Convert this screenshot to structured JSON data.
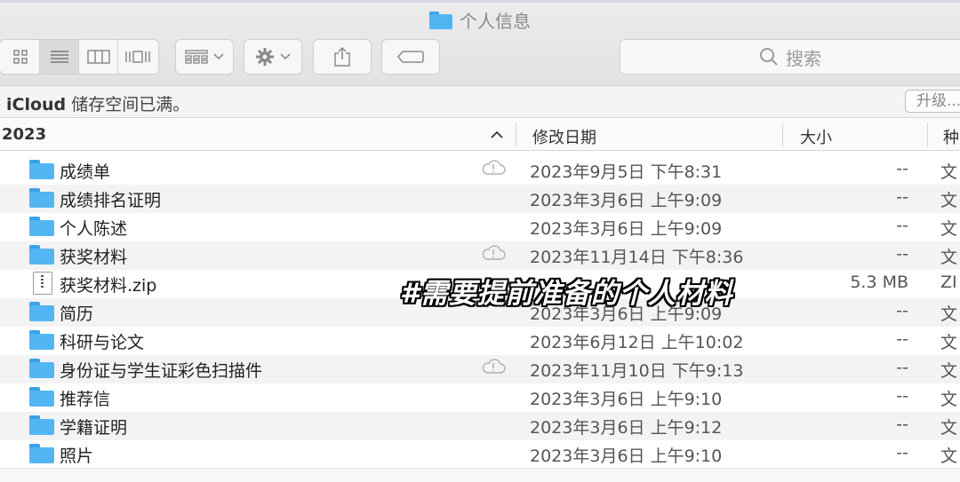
{
  "window": {
    "title": "个人信息"
  },
  "toolbar": {
    "view_buttons": [
      {
        "icon": "icon-view-icon",
        "active": false
      },
      {
        "icon": "list-view-icon",
        "active": true
      },
      {
        "icon": "column-view-icon",
        "active": false
      },
      {
        "icon": "gallery-view-icon",
        "active": false
      }
    ],
    "group_icon": "group-grid-icon",
    "action_icon": "gear-icon",
    "share_icon": "share-icon",
    "tag_icon": "tag-icon",
    "search_placeholder": "搜索"
  },
  "icloud_bar": {
    "brand": "iCloud",
    "message": "储存空间已满。",
    "upgrade_label": "升级..."
  },
  "columns": {
    "name": "2023",
    "date": "修改日期",
    "size": "大小",
    "kind": "种"
  },
  "files": [
    {
      "name": "成绩单",
      "date": "2023年9月5日 下午8:31",
      "size": "--",
      "kind": "文",
      "type": "folder",
      "cloud": true
    },
    {
      "name": "成绩排名证明",
      "date": "2023年3月6日 上午9:09",
      "size": "--",
      "kind": "文",
      "type": "folder",
      "cloud": false
    },
    {
      "name": "个人陈述",
      "date": "2023年3月6日 上午9:09",
      "size": "--",
      "kind": "文",
      "type": "folder",
      "cloud": false
    },
    {
      "name": "获奖材料",
      "date": "2023年11月14日 下午8:36",
      "size": "--",
      "kind": "文",
      "type": "folder",
      "cloud": true
    },
    {
      "name": "获奖材料.zip",
      "date": "",
      "size": "5.3 MB",
      "kind": "ZI",
      "type": "zip",
      "cloud": false
    },
    {
      "name": "简历",
      "date": "2023年3月6日 上午9:09",
      "size": "--",
      "kind": "文",
      "type": "folder",
      "cloud": false
    },
    {
      "name": "科研与论文",
      "date": "2023年6月12日 上午10:02",
      "size": "--",
      "kind": "文",
      "type": "folder",
      "cloud": false
    },
    {
      "name": "身份证与学生证彩色扫描件",
      "date": "2023年11月10日 下午9:13",
      "size": "--",
      "kind": "文",
      "type": "folder",
      "cloud": true
    },
    {
      "name": "推荐信",
      "date": "2023年3月6日 上午9:10",
      "size": "--",
      "kind": "文",
      "type": "folder",
      "cloud": false
    },
    {
      "name": "学籍证明",
      "date": "2023年3月6日 上午9:12",
      "size": "--",
      "kind": "文",
      "type": "folder",
      "cloud": false
    },
    {
      "name": "照片",
      "date": "2023年3月6日 上午9:10",
      "size": "--",
      "kind": "文",
      "type": "folder",
      "cloud": false
    }
  ],
  "overlay_caption": "#需要提前准备的个人材料"
}
